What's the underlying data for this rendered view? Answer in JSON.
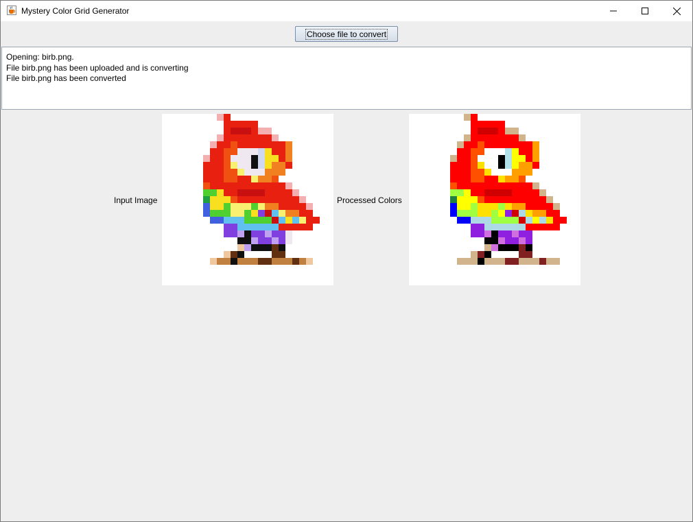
{
  "window": {
    "title": "Mystery Color Grid Generator",
    "icon": "java-cup-icon",
    "controls": [
      "minimize",
      "maximize",
      "close"
    ]
  },
  "toolbar": {
    "choose_label": "Choose file to convert"
  },
  "log": {
    "lines": [
      "Opening: birb.png.",
      "File birb.png has been uploaded and is converting",
      "File birb.png has been converted"
    ]
  },
  "images": {
    "input_label": "Input Image",
    "processed_label": "Processed Colors"
  },
  "colors": {
    "window_bg": "#eeeeee",
    "titlebar_bg": "#ffffff",
    "text_bg": "#ffffff"
  }
}
